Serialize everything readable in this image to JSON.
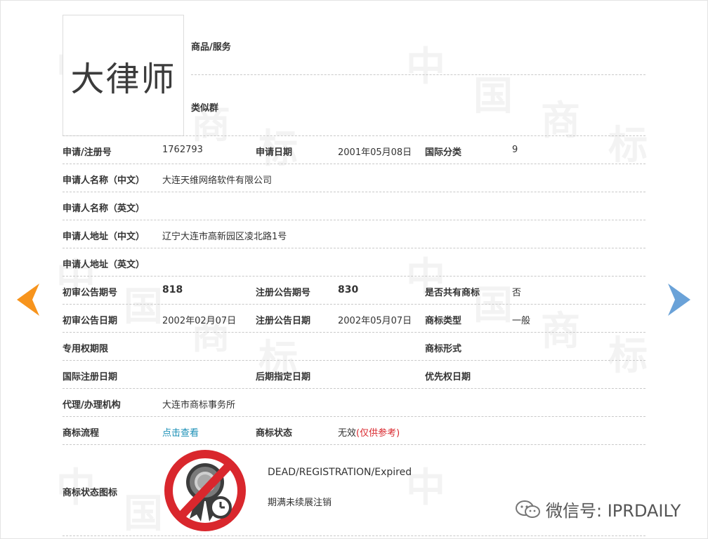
{
  "mark": {
    "text": "大律师"
  },
  "header": {
    "goods_label": "商品/服务",
    "group_label": "类似群"
  },
  "rows": {
    "r1": {
      "l1": "申请/注册号",
      "v1": "1762793",
      "l2": "申请日期",
      "v2": "2001年05月08日",
      "l3": "国际分类",
      "v3": "9"
    },
    "r2": {
      "l1": "申请人名称（中文）",
      "v1": "大连天维网络软件有限公司"
    },
    "r3": {
      "l1": "申请人名称（英文）"
    },
    "r4": {
      "l1": "申请人地址（中文）",
      "v1": "辽宁大连市高新园区凌北路1号"
    },
    "r5": {
      "l1": "申请人地址（英文）"
    },
    "r6": {
      "l1": "初审公告期号",
      "v1": "818",
      "l2": "注册公告期号",
      "v2": "830",
      "l3": "是否共有商标",
      "v3": "否"
    },
    "r7": {
      "l1": "初审公告日期",
      "v1": "2002年02月07日",
      "l2": "注册公告日期",
      "v2": "2002年05月07日",
      "l3": "商标类型",
      "v3": "一般"
    },
    "r8": {
      "l1": "专用权期限",
      "l3": "商标形式"
    },
    "r9": {
      "l1": "国际注册日期",
      "l2": "后期指定日期",
      "l3": "优先权日期"
    },
    "r10": {
      "l1": "代理/办理机构",
      "v1": "大连市商标事务所"
    },
    "r11": {
      "l1": "商标流程",
      "v1": "点击查看",
      "l2": "商标状态",
      "v2": "无效",
      "v2_note": "(仅供参考)"
    }
  },
  "status_icon": {
    "label": "商标状态图标",
    "icon": "expired-registration-icon",
    "text_en": "DEAD/REGISTRATION/Expired",
    "text_cn": "期满未续展注销"
  },
  "watermark": {
    "chars": [
      "中",
      "国",
      "商",
      "标"
    ],
    "wechat_text": "微信号: IPRDAILY"
  },
  "nav": {
    "prev_icon": "arrow-left-icon",
    "next_icon": "arrow-right-icon"
  },
  "colors": {
    "prev_arrow": "#f7941d",
    "next_arrow": "#6aa2d8",
    "link": "#1a8fb6",
    "ref_red": "#d9272d",
    "no_sign_red": "#d9272d"
  }
}
